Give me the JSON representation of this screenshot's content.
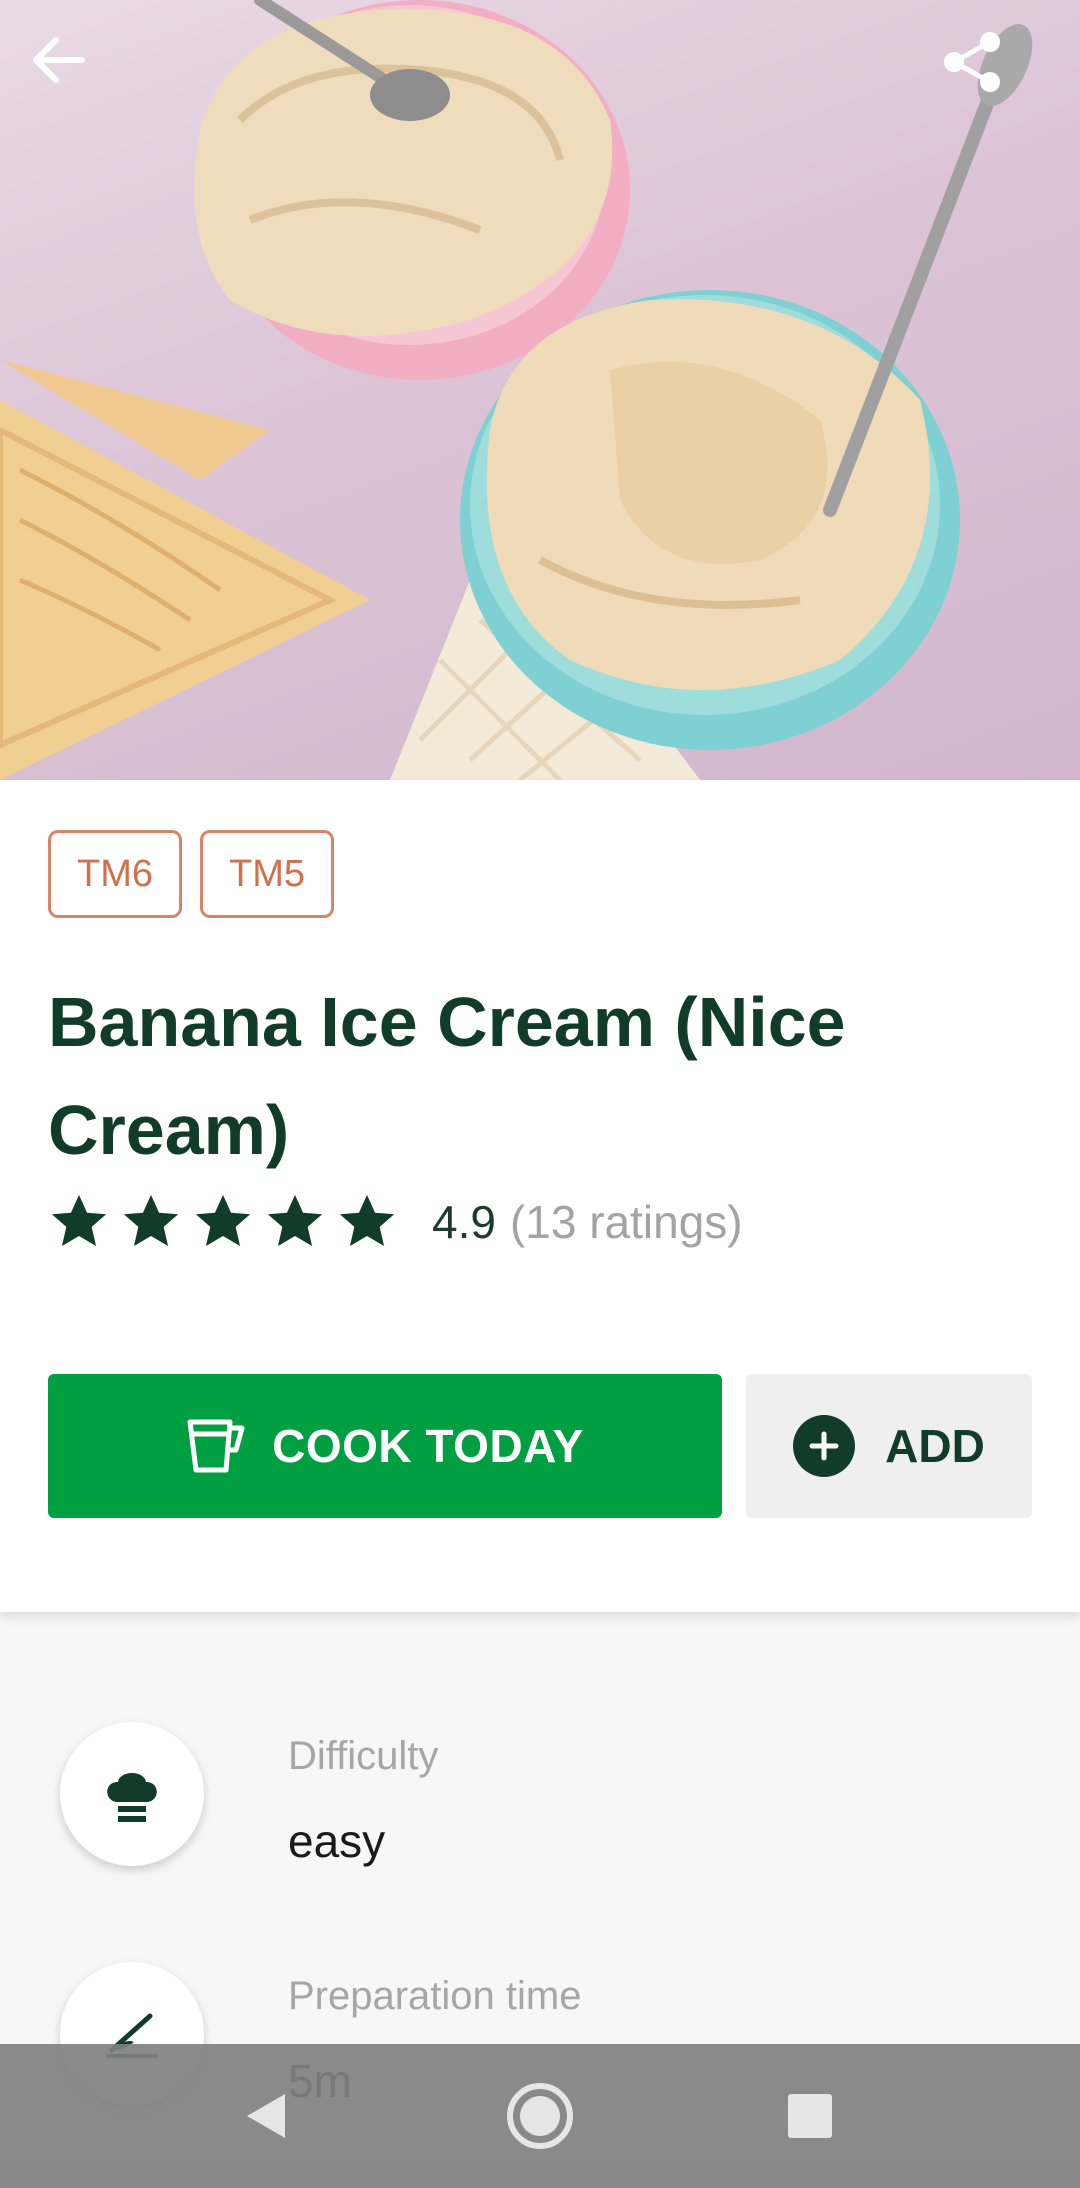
{
  "hero": {
    "back_icon": "arrow-left-icon",
    "share_icon": "share-icon"
  },
  "tags": [
    "TM6",
    "TM5"
  ],
  "recipe": {
    "title": "Banana Ice Cream (Nice Cream)",
    "rating_value": "4.9",
    "rating_count": "(13 ratings)",
    "stars_filled": 5,
    "stars_total": 5
  },
  "actions": {
    "cook_label": "COOK TODAY",
    "add_label": "ADD"
  },
  "info": [
    {
      "label": "Difficulty",
      "value": "easy",
      "icon": "chef-hat-icon"
    },
    {
      "label": "Preparation time",
      "value": "5m",
      "icon": "knife-icon"
    }
  ],
  "colors": {
    "primary_green": "#00a042",
    "dark_green": "#113c2a",
    "tag_orange": "#d2704c"
  },
  "navbar": {
    "icons": [
      "nav-back-icon",
      "nav-home-icon",
      "nav-recents-icon"
    ]
  }
}
